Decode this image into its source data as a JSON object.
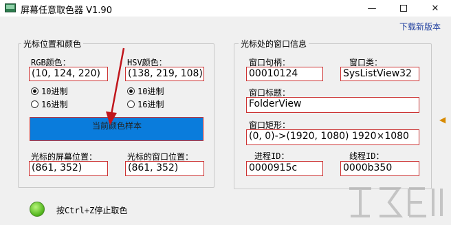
{
  "window": {
    "title": "屏幕任意取色器 V1.90",
    "minimize": "—",
    "maximize": "",
    "close": "✕"
  },
  "header": {
    "download_link": "下载新版本"
  },
  "left_group": {
    "title": "光标位置和颜色",
    "rgb_label": "RGB颜色：",
    "rgb_value": "(10, 124, 220)",
    "hsv_label": "HSV颜色：",
    "hsv_value": "(138, 219, 108)",
    "rgb_radio": [
      {
        "label": "10进制",
        "checked": true
      },
      {
        "label": "16进制",
        "checked": false
      }
    ],
    "hsv_radio": [
      {
        "label": "10进制",
        "checked": true
      },
      {
        "label": "16进制",
        "checked": false
      }
    ],
    "sample_label": "当前颜色样本",
    "sample_color": "#0a7cdc",
    "screen_pos_label": "光标的屏幕位置：",
    "screen_pos_value": "(861, 352)",
    "window_pos_label": "光标的窗口位置：",
    "window_pos_value": "(861, 352)"
  },
  "right_group": {
    "title": "光标处的窗口信息",
    "handle_label": "窗口句柄：",
    "handle_value": "00010124",
    "class_label": "窗口类：",
    "class_value": "SysListView32",
    "caption_label": "窗口标题：",
    "caption_value": "FolderView",
    "rect_label": "窗口矩形：",
    "rect_value": "(0, 0)->(1920, 1080) 1920×1080",
    "pid_label": "进程ID：",
    "pid_value": "0000915c",
    "tid_label": "线程ID：",
    "tid_value": "0000b350"
  },
  "status": {
    "text": "按Ctrl+Z停止取色",
    "led_color": "#4fb31a"
  },
  "colors": {
    "accent_red": "#cc3333",
    "link_blue": "#1f3f9f"
  }
}
